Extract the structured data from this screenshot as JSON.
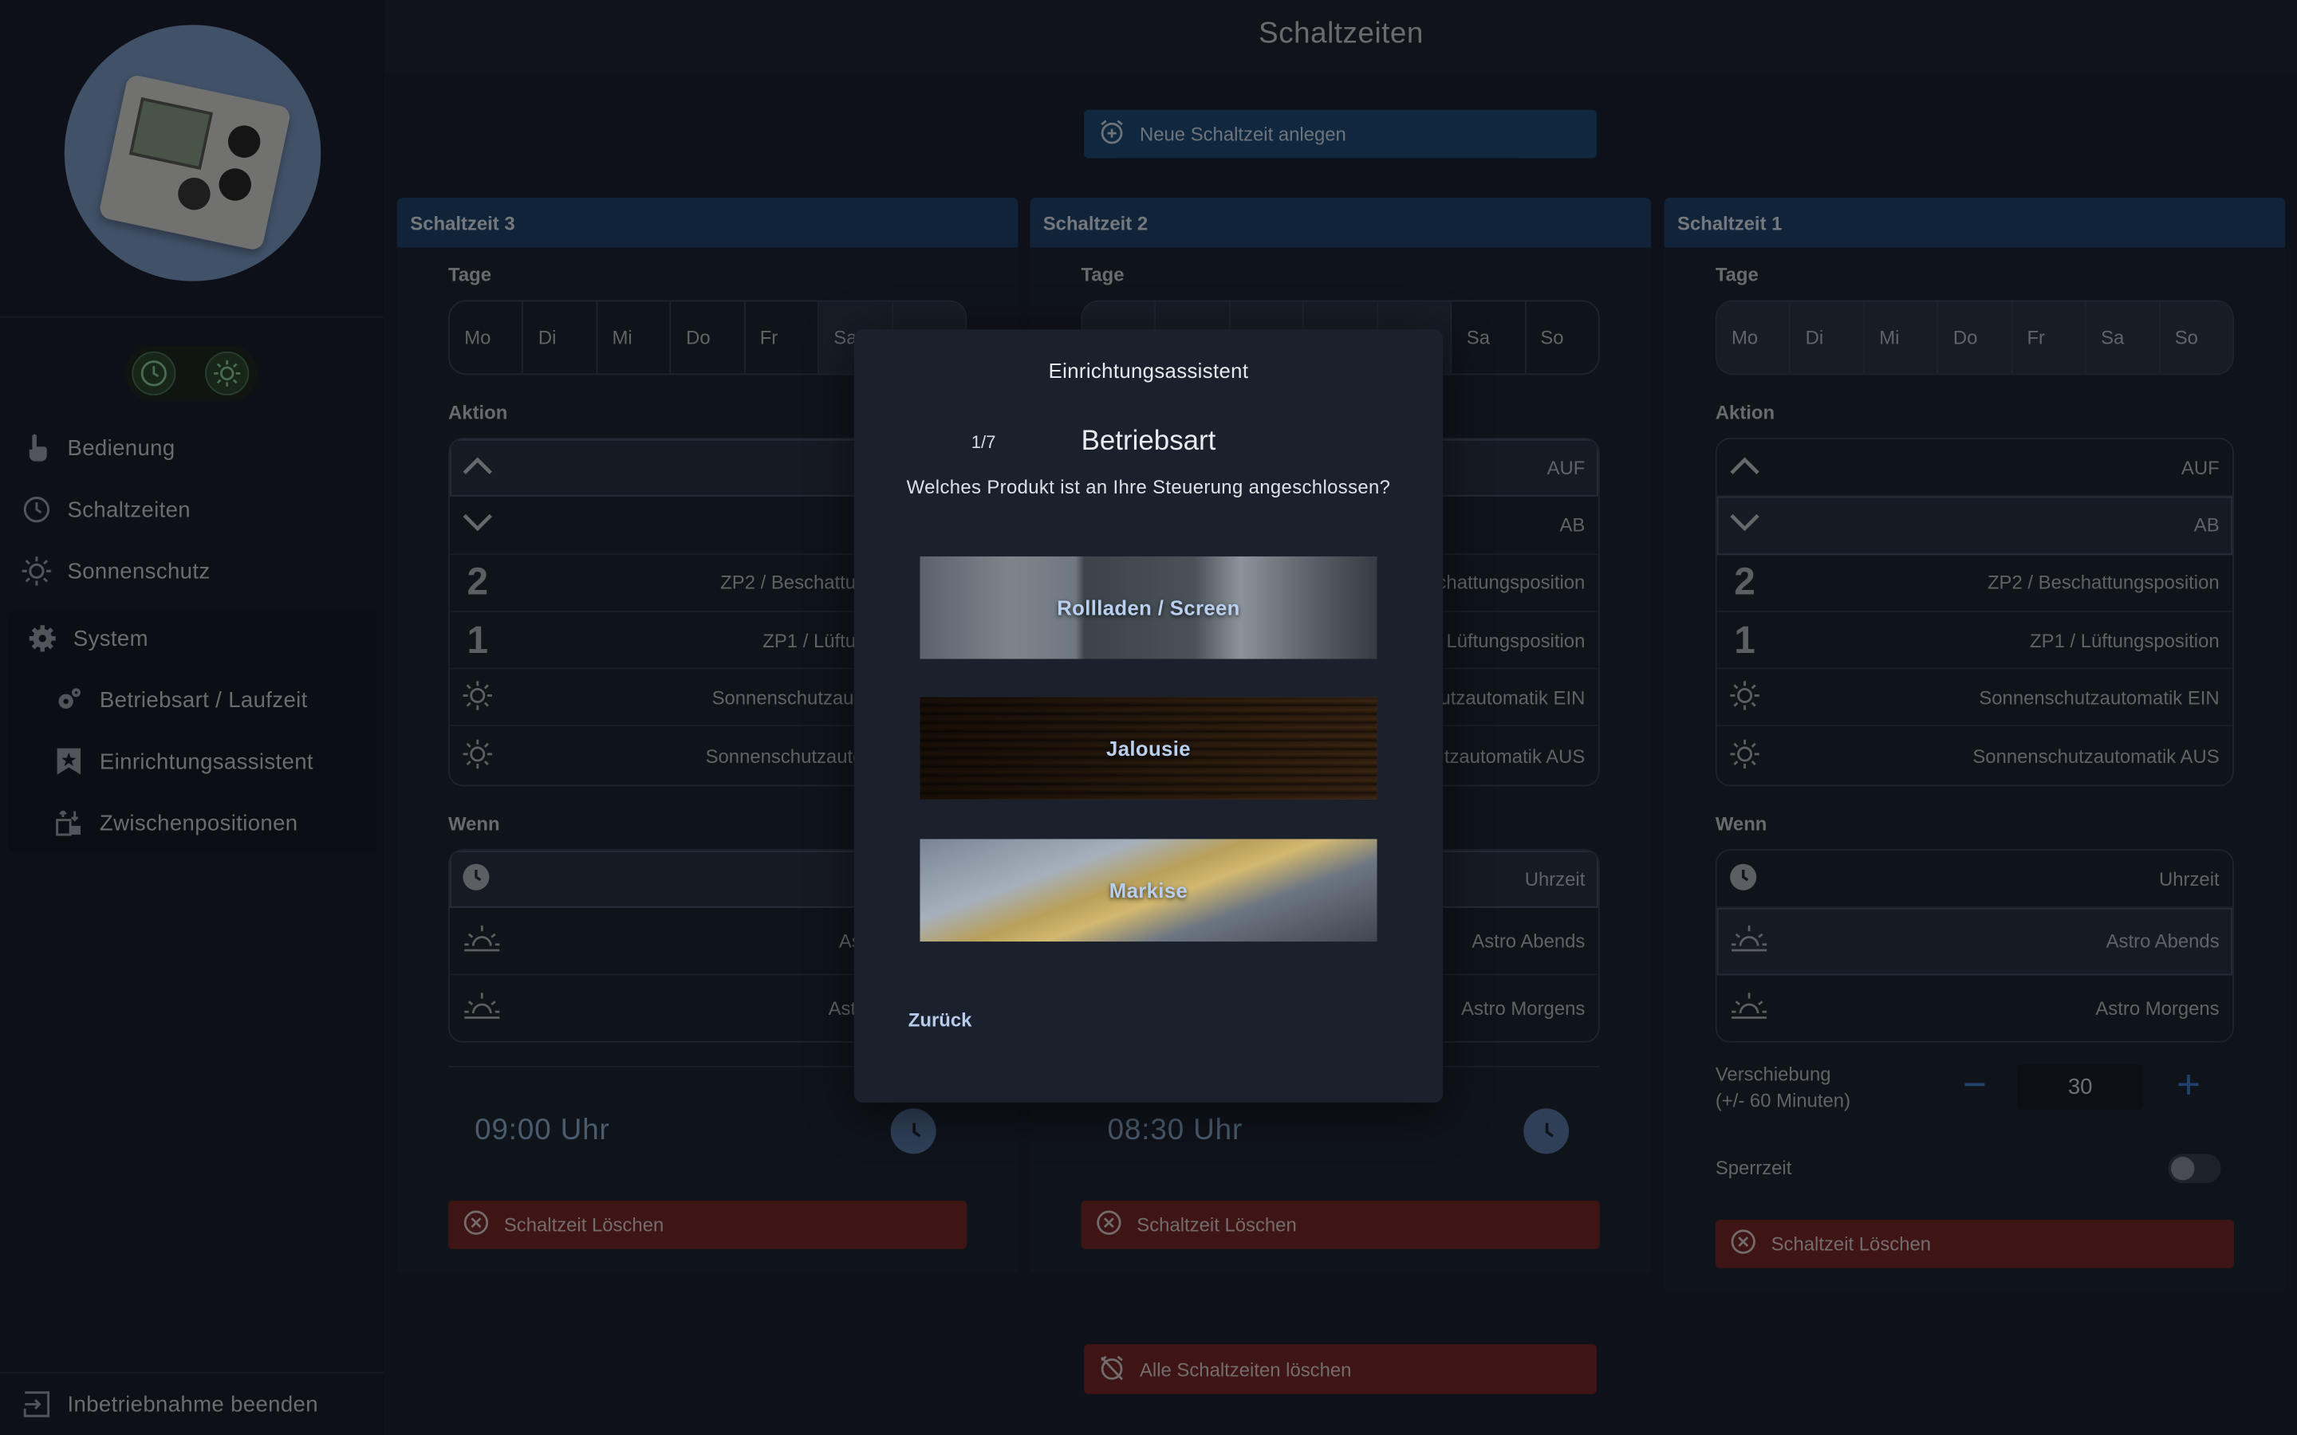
{
  "app": {
    "title": "Schaltzeiten"
  },
  "sidebar": {
    "items": [
      {
        "label": "Bedienung",
        "icon": "hand-pointer-icon"
      },
      {
        "label": "Schaltzeiten",
        "icon": "clock-icon"
      },
      {
        "label": "Sonnenschutz",
        "icon": "sun-icon"
      }
    ],
    "system": {
      "label": "System",
      "icon": "gear-icon",
      "subitems": [
        {
          "label": "Betriebsart / Laufzeit",
          "icon": "gears-icon"
        },
        {
          "label": "Einrichtungsassistent",
          "icon": "magic-star-icon"
        },
        {
          "label": "Zwischenpositionen",
          "icon": "position-icon"
        }
      ]
    },
    "footer": {
      "label": "Inbetriebnahme beenden",
      "icon": "exit-icon"
    }
  },
  "actions": {
    "new_label": "Neue Schaltzeit anlegen",
    "delete_all_label": "Alle Schaltzeiten löschen"
  },
  "labels": {
    "tage": "Tage",
    "aktion": "Aktion",
    "wenn": "Wenn",
    "delete": "Schaltzeit Löschen"
  },
  "days": [
    "Mo",
    "Di",
    "Mi",
    "Do",
    "Fr",
    "Sa",
    "So"
  ],
  "aktion_options": [
    "AUF",
    "AB",
    "ZP2 / Beschattungsposition",
    "ZP1 / Lüftungsposition",
    "Sonnenschutzautomatik EIN",
    "Sonnenschutzautomatik AUS"
  ],
  "aktion_nums": [
    "2",
    "1"
  ],
  "wenn_options": [
    "Uhrzeit",
    "Astro Abends",
    "Astro Morgens"
  ],
  "cards": [
    {
      "title": "Schaltzeit 3",
      "time": "09:00 Uhr"
    },
    {
      "title": "Schaltzeit 2",
      "time": "08:30 Uhr"
    },
    {
      "title": "Schaltzeit 1",
      "verschiebung_label": "Verschiebung",
      "verschiebung_hint": "(+/- 60 Minuten)",
      "verschiebung_value": "30",
      "sperrzeit_label": "Sperrzeit",
      "sperrzeit_on": false
    }
  ],
  "modal": {
    "title": "Einrichtungsassistent",
    "step": "1/7",
    "step_title": "Betriebsart",
    "question": "Welches Produkt ist an Ihre Steuerung angeschlossen?",
    "products": [
      "Rollladen / Screen",
      "Jalousie",
      "Markise"
    ],
    "back_label": "Zurück"
  },
  "colors": {
    "header_blue": "#20446b",
    "primary_button": "#1f4d7a",
    "danger_button": "#7a2727",
    "accent_blue": "#3f7fd0"
  }
}
